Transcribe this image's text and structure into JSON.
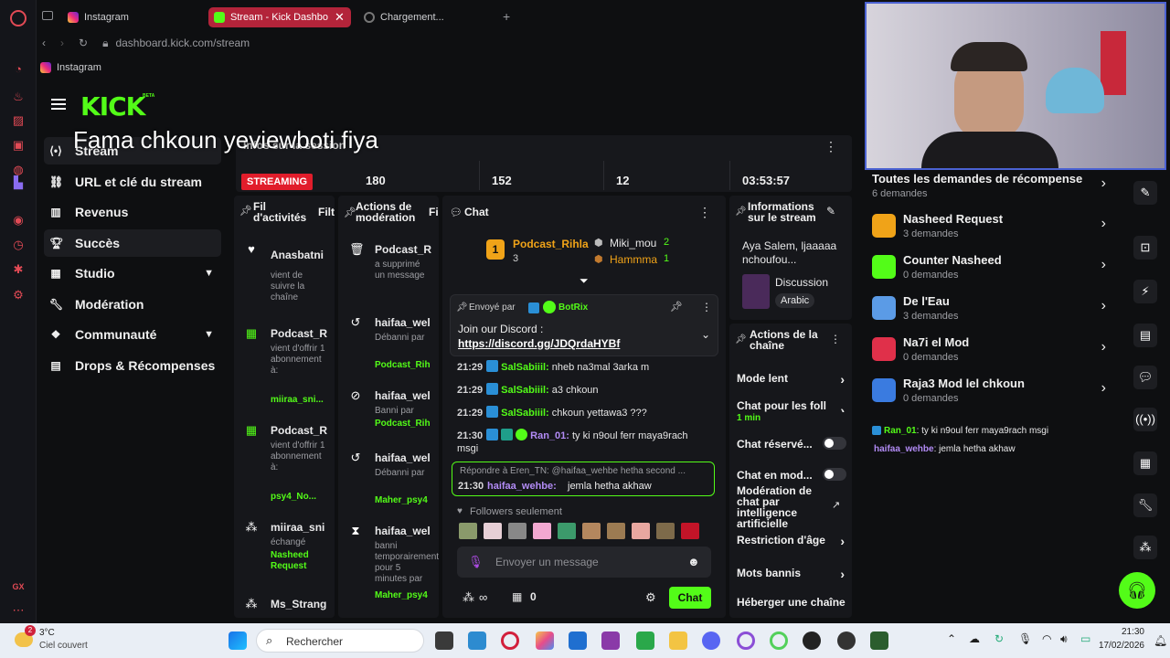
{
  "browser": {
    "tabs": [
      {
        "label": "Instagram",
        "active": false
      },
      {
        "label": "Stream - Kick Dashbo",
        "active": true
      },
      {
        "label": "Chargement...",
        "active": false
      }
    ],
    "new_tab": "+",
    "url": "dashboard.kick.com/stream",
    "bookmark": "Instagram"
  },
  "kick": {
    "logo": "KICK",
    "logo_badge": "BETA",
    "overlay_text": "Fama chkoun yeviewboti fiya",
    "nav": [
      {
        "label": "Stream",
        "icon": "stream-icon",
        "selected": true
      },
      {
        "label": "URL et clé du stream",
        "icon": "link-icon",
        "selected": false
      },
      {
        "label": "Revenus",
        "icon": "chart-icon",
        "selected": false
      },
      {
        "label": "Succès",
        "icon": "trophy-icon",
        "selected": true
      },
      {
        "label": "Studio",
        "icon": "studio-icon",
        "selected": false,
        "expand": true
      },
      {
        "label": "Modération",
        "icon": "wrench-icon",
        "selected": false
      },
      {
        "label": "Communauté",
        "icon": "community-icon",
        "selected": false,
        "expand": true
      },
      {
        "label": "Drops & Récompenses",
        "icon": "drops-icon",
        "selected": false
      }
    ]
  },
  "session": {
    "title": "Infos sur la session",
    "status": "STREAMING",
    "stats": [
      "180",
      "152",
      "12",
      "03:53:57"
    ]
  },
  "activity": {
    "title": "Fil d'activités",
    "filter": "Filtr",
    "items": [
      {
        "icon": "heart-icon",
        "name": "Anasbatni",
        "desc": "vient de suivre la chaîne",
        "extra": ""
      },
      {
        "icon": "gift-icon",
        "name": "Podcast_R",
        "desc": "vient d'offrir 1 abonnement à:",
        "extra": "miiraa_sni..."
      },
      {
        "icon": "gift-icon",
        "name": "Podcast_R",
        "desc": "vient d'offrir 1 abonnement à:",
        "extra": "psy4_No..."
      },
      {
        "icon": "points-icon",
        "name": "miiraa_sni",
        "desc": "échangé",
        "extra": "Nasheed Request"
      },
      {
        "icon": "points-icon",
        "name": "Ms_Strang",
        "desc": "",
        "extra": ""
      }
    ]
  },
  "modactions": {
    "title": "Actions de modération",
    "filter": "Fil",
    "items": [
      {
        "icon": "trash-icon",
        "name": "Podcast_R",
        "desc": "a supprimé un message",
        "extra": ""
      },
      {
        "icon": "undo-icon",
        "name": "haifaa_wel",
        "desc": "Débanni par",
        "extra": "Podcast_Rih"
      },
      {
        "icon": "ban-icon",
        "name": "haifaa_wel",
        "desc": "Banni par",
        "extra": "Podcast_Rih"
      },
      {
        "icon": "undo-icon",
        "name": "haifaa_wel",
        "desc": "Débanni par",
        "extra": "Maher_psy4"
      },
      {
        "icon": "hourglass-icon",
        "name": "haifaa_wel",
        "desc": "banni temporairement pour 5 minutes par",
        "extra": "Maher_psy4"
      }
    ]
  },
  "chat": {
    "title": "Chat",
    "leaderboard": [
      {
        "rank": "1",
        "name": "Podcast_Rihla",
        "count": "3"
      },
      {
        "rank": "",
        "name": "Miki_mou",
        "count": "2"
      },
      {
        "rank": "",
        "name": "Hammma",
        "count": "1"
      }
    ],
    "pinned": {
      "sent_by": "Envoyé par",
      "bot": "BotRix",
      "text": "Join our Discord :",
      "link": "https://discord.gg/JDQrdaHYBf"
    },
    "messages": [
      {
        "time": "21:29",
        "user": "SalSabiiil:",
        "text": "nheb na3mal 3arka m"
      },
      {
        "time": "21:29",
        "user": "SalSabiiil:",
        "text": "a3 chkoun"
      },
      {
        "time": "21:29",
        "user": "SalSabiiil:",
        "text": "chkoun yettawa3 ???"
      },
      {
        "time": "21:30",
        "user": "Ran_01:",
        "text": "ty ki n9oul ferr maya9rach"
      },
      {
        "time": "",
        "user": "",
        "text": "msgi"
      }
    ],
    "reply": {
      "context": "Répondre à Eren_TN: @haifaa_wehbe hetha second ...",
      "time": "21:30",
      "user": "haifaa_wehbe:",
      "text": "jemla hetha akhaw"
    },
    "followers_only": "Followers seulement",
    "input_placeholder": "Envoyer un message",
    "points": "∞",
    "gifts": "0",
    "send": "Chat"
  },
  "info": {
    "title": "Informations sur le stream",
    "stream_title": "Aya Salem, ljaaaaa nchoufou...",
    "category": "Discussion",
    "tag": "Arabic"
  },
  "channel_actions": {
    "title": "Actions de la chaîne",
    "items": [
      {
        "label": "Mode lent",
        "sub": "",
        "control": "arrow"
      },
      {
        "label": "Chat pour les foll",
        "sub": "1 min",
        "control": "arrow"
      },
      {
        "label": "Chat réservé...",
        "sub": "",
        "control": "toggle"
      },
      {
        "label": "Chat en mod...",
        "sub": "",
        "control": "toggle"
      },
      {
        "label": "Modération de chat par intelligence artificielle",
        "sub": "",
        "control": "external"
      },
      {
        "label": "Restriction d'âge",
        "sub": "",
        "control": "arrow"
      },
      {
        "label": "Mots bannis",
        "sub": "",
        "control": "arrow"
      },
      {
        "label": "Héberger une chaîne",
        "sub": "",
        "control": "none"
      }
    ]
  },
  "rewards": {
    "all": {
      "title": "Toutes les demandes de récompense",
      "sub": "6 demandes"
    },
    "items": [
      {
        "title": "Nasheed Request",
        "sub": "3 demandes",
        "color": "#f0a318"
      },
      {
        "title": "Counter Nasheed",
        "sub": "0 demandes",
        "color": "#53fc18"
      },
      {
        "title": "De l'Eau",
        "sub": "3 demandes",
        "color": "#5b9be6"
      },
      {
        "title": "Na7i el Mod",
        "sub": "0 demandes",
        "color": "#e0304a"
      },
      {
        "title": "Raja3 Mod lel chkoun",
        "sub": "0 demandes",
        "color": "#3a7be0"
      }
    ]
  },
  "overlay_chat": [
    {
      "user": "Ran_01",
      "text": ": ty ki n9oul ferr maya9rach msgi"
    },
    {
      "user": "haifaa_wehbe",
      "text": ": jemla hetha akhaw"
    }
  ],
  "taskbar": {
    "weather_temp": "3°C",
    "weather_desc": "Ciel couvert",
    "weather_badge": "2",
    "search": "Rechercher",
    "time": "21:30",
    "date": "17/02/2026"
  },
  "colors": {
    "kick_green": "#53fc18",
    "opera_red": "#e24a55",
    "live_red": "#e11d2b"
  }
}
